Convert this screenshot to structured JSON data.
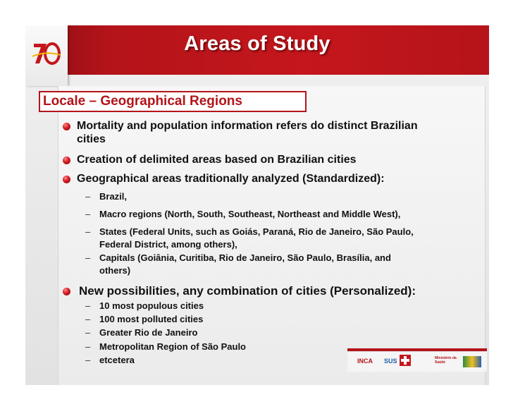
{
  "slide": {
    "title": "Areas of Study",
    "subtitle": "Locale – Geographical Regions",
    "bullets": [
      {
        "text": "Mortality and population information refers do distinct Brazilian",
        "text2": "cities"
      },
      {
        "text": "Creation of delimited areas based on Brazilian cities"
      },
      {
        "text": "Geographical areas traditionally analyzed (Standardized):",
        "subs": [
          {
            "line1": "Brazil,"
          },
          {
            "line1": "Macro regions (North, South, Southeast, Northeast and Middle West),"
          },
          {
            "line1": "States (Federal Units, such as Goiás, Paraná, Rio de Janeiro, São Paulo,",
            "line2": "Federal District, among others),"
          },
          {
            "line1": "Capitals (Goiânia, Curitiba, Rio de Janeiro, São Paulo, Brasília, and",
            "line2": "others)"
          }
        ]
      },
      {
        "text": "New possibilities, any combination of cities (Personalized):",
        "subs": [
          {
            "line1": "10 most populous cities"
          },
          {
            "line1": "100 most polluted cities"
          },
          {
            "line1": "Greater Rio de Janeiro"
          },
          {
            "line1": "Metropolitan Region of São Paulo"
          },
          {
            "line1": "etcetera"
          }
        ]
      }
    ],
    "dash": "–"
  },
  "footer": {
    "inca": "INCA",
    "sus": "SUS",
    "ministerio": "Ministério da Saúde"
  },
  "colors": {
    "accent": "#c4161c",
    "text": "#111111"
  },
  "icons": [
    "logo-70-icon",
    "bullet-dot-icon",
    "inca-logo-icon",
    "sus-cross-icon",
    "brasil-logo-icon"
  ]
}
